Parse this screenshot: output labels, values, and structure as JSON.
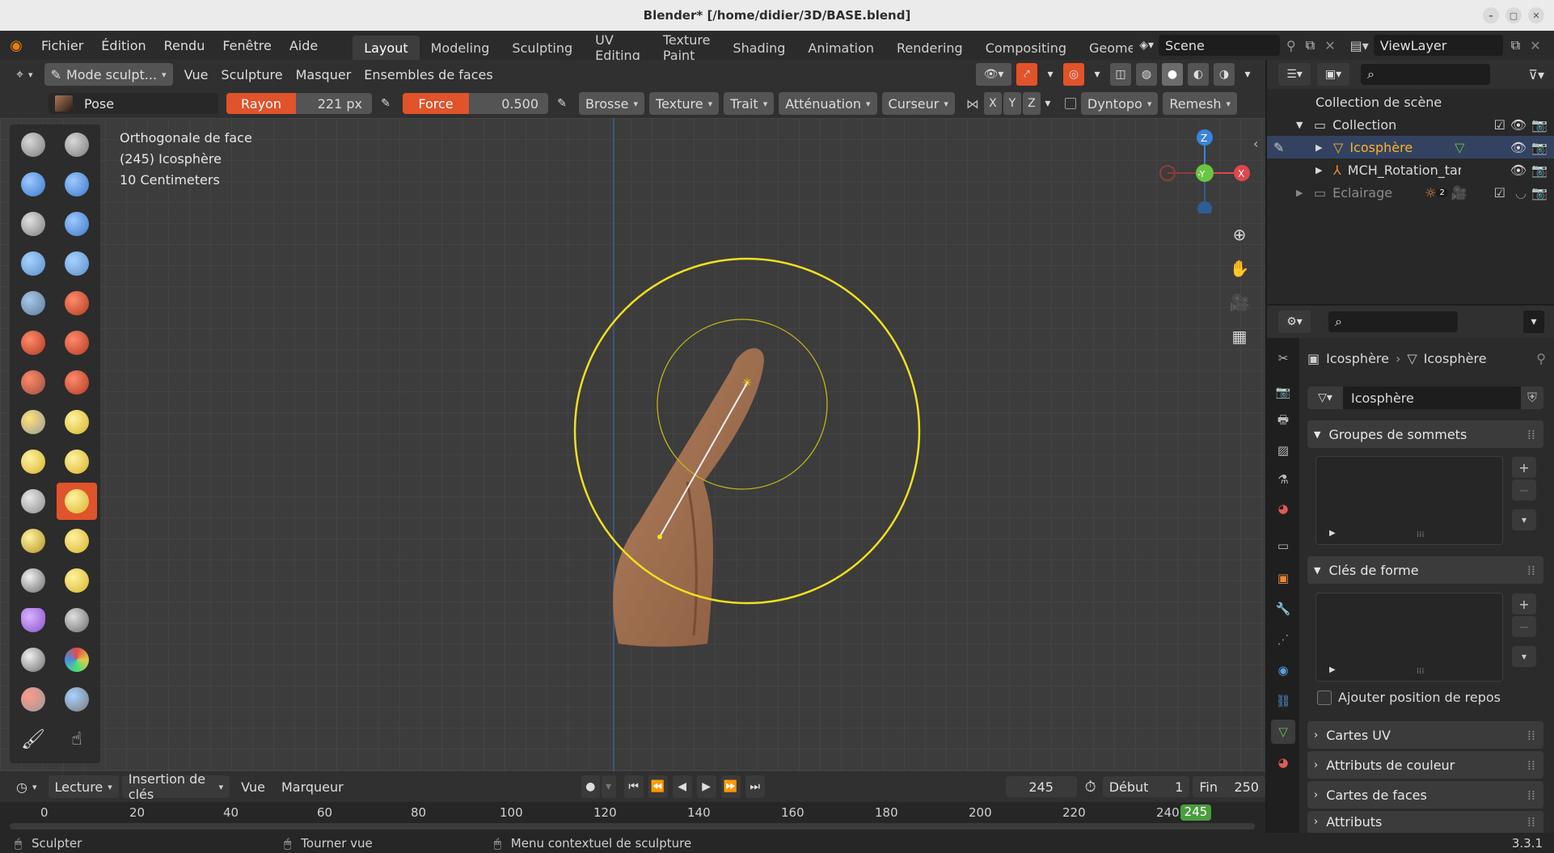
{
  "window": {
    "title": "Blender* [/home/didier/3D/BASE.blend]"
  },
  "menu": [
    "Fichier",
    "Édition",
    "Rendu",
    "Fenêtre",
    "Aide"
  ],
  "workspaces": [
    "Layout",
    "Modeling",
    "Sculpting",
    "UV Editing",
    "Texture Paint",
    "Shading",
    "Animation",
    "Rendering",
    "Compositing",
    "Geome"
  ],
  "active_workspace": "Layout",
  "scene": {
    "label": "Scene"
  },
  "view_layer": {
    "label": "ViewLayer"
  },
  "header1": {
    "mode": "Mode sculpt...",
    "items": [
      "Vue",
      "Sculpture",
      "Masquer",
      "Ensembles de faces"
    ]
  },
  "header2": {
    "brush": "Pose",
    "radius_label": "Rayon",
    "radius_value": "221 px",
    "strength_label": "Force",
    "strength_value": "0.500",
    "menus": [
      "Brosse",
      "Texture",
      "Trait",
      "Atténuation",
      "Curseur"
    ],
    "axes": [
      "X",
      "Y",
      "Z"
    ],
    "dyntopo": "Dyntopo",
    "remesh": "Remesh"
  },
  "viewport": {
    "overlay": [
      "Orthogonale de face",
      "(245) Icosphère",
      "10 Centimeters"
    ]
  },
  "gizmo": {
    "z": "Z",
    "y": "-Y",
    "x": "X"
  },
  "outliner": {
    "root": "Collection de scène",
    "items": [
      {
        "label": "Collection"
      },
      {
        "label": "Icosphère"
      },
      {
        "label": "MCH_Rotation_targ"
      },
      {
        "label": "Eclairage",
        "badge": "2"
      }
    ]
  },
  "properties": {
    "breadcrumb": [
      "Icosphère",
      "Icosphère"
    ],
    "data_name": "Icosphère",
    "panels": [
      "Groupes de sommets",
      "Clés de forme",
      "Cartes UV",
      "Attributs de couleur",
      "Cartes de faces",
      "Attributs"
    ],
    "checkbox": "Ajouter position de repos"
  },
  "timeline": {
    "menus": [
      "Lecture",
      "Insertion de clés",
      "Vue",
      "Marqueur"
    ],
    "current_frame": "245",
    "start_label": "Début",
    "start": "1",
    "end_label": "Fin",
    "end": "250",
    "ruler": [
      "0",
      "20",
      "40",
      "60",
      "80",
      "100",
      "120",
      "140",
      "160",
      "180",
      "200",
      "220",
      "240"
    ],
    "playhead": "245"
  },
  "status": {
    "items": [
      "Sculpter",
      "Tourner vue",
      "Menu contextuel de sculpture"
    ],
    "version": "3.3.1"
  },
  "colors": {
    "accent": "#e0532b",
    "brush_circle": "#f0e020",
    "selected_text": "#ffaf29",
    "gizmo_x": "#e0474c",
    "gizmo_y": "#6ac543",
    "gizmo_z": "#3b84d9",
    "playhead": "#4a9d3f"
  }
}
